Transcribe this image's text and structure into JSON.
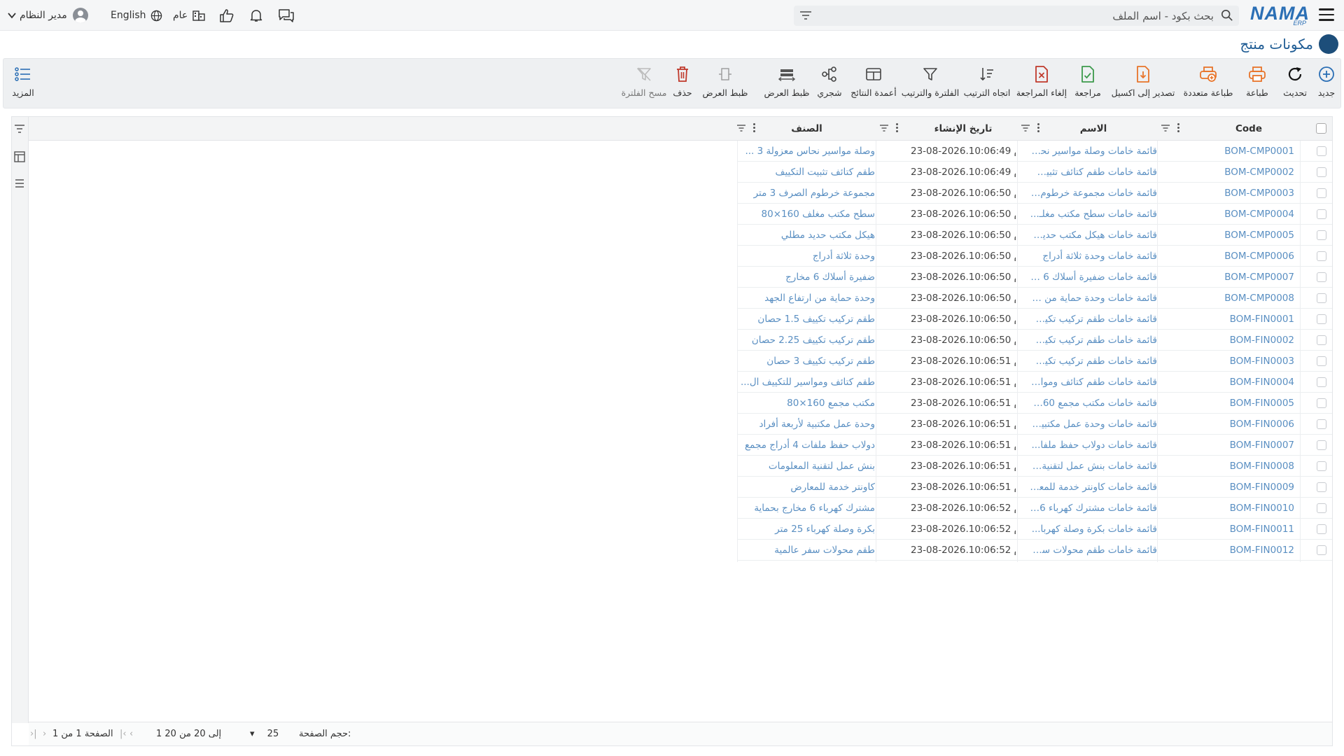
{
  "topbar": {
    "search_placeholder": "بحث بكود - اسم الملف",
    "logo_text": "NAMA",
    "logo_sub": "ERP",
    "user_label": "مدير النظام",
    "language_label": "English",
    "branch_label": "عام"
  },
  "page": {
    "title": "مكونات منتج"
  },
  "toolbar": {
    "new": "جديد",
    "refresh": "تحديث",
    "print": "طباعة",
    "multi_print": "طباعة متعددة",
    "export_excel": "تصدير إلى اكسيل",
    "review": "مراجعة",
    "cancel_review": "إلغاء المراجعة",
    "sort_direction": "اتجاه الترتيب",
    "filter_sort": "الفلترة والترتيب",
    "result_columns": "أعمدة النتائج",
    "tree": "شجري",
    "fit_width_1": "ظبط العرض",
    "fit_width_2": "ظبط العرض",
    "delete": "حذف",
    "clear_filter": "مسح الفلترة",
    "more": "المزيد"
  },
  "grid": {
    "columns": {
      "code": "Code",
      "name": "الاسم",
      "created": "تاريخ الإنشاء",
      "category": "الصنف"
    },
    "rows": [
      {
        "code": "BOM-CMP0001",
        "name": "قائمة خامات وصلة مواسير نحا...",
        "created": "23-08-2026.10:06:49 م",
        "category": "وصلة مواسير نحاس معزولة 3 ..."
      },
      {
        "code": "BOM-CMP0002",
        "name": "قائمة خامات طقم كتائف تثبيت...",
        "created": "23-08-2026.10:06:49 م",
        "category": "طقم كتائف تثبيت التكييف"
      },
      {
        "code": "BOM-CMP0003",
        "name": "قائمة خامات مجموعة خرطوم ال...",
        "created": "23-08-2026.10:06:50 م",
        "category": "مجموعة خرطوم الصرف 3 متر"
      },
      {
        "code": "BOM-CMP0004",
        "name": "قائمة خامات سطح مكتب مغلـ...",
        "created": "23-08-2026.10:06:50 م",
        "category": "سطح مكتب مغلف 160×80"
      },
      {
        "code": "BOM-CMP0005",
        "name": "قائمة خامات هيكل مكتب حديد ...",
        "created": "23-08-2026.10:06:50 م",
        "category": "هيكل مكتب حديد مطلي"
      },
      {
        "code": "BOM-CMP0006",
        "name": "قائمة خامات وحدة ثلاثة أدراج",
        "created": "23-08-2026.10:06:50 م",
        "category": "وحدة ثلاثة أدراج"
      },
      {
        "code": "BOM-CMP0007",
        "name": "قائمة خامات ضفيرة أسلاك 6 م...",
        "created": "23-08-2026.10:06:50 م",
        "category": "ضفيرة أسلاك 6 مخارج"
      },
      {
        "code": "BOM-CMP0008",
        "name": "قائمة خامات وحدة حماية من ارت...",
        "created": "23-08-2026.10:06:50 م",
        "category": "وحدة حماية من ارتفاع الجهد"
      },
      {
        "code": "BOM-FIN0001",
        "name": "قائمة خامات طقم تركيب تكيي...",
        "created": "23-08-2026.10:06:50 م",
        "category": "طقم تركيب تكييف 1.5 حصان"
      },
      {
        "code": "BOM-FIN0002",
        "name": "قائمة خامات طقم تركيب تكيي...",
        "created": "23-08-2026.10:06:50 م",
        "category": "طقم تركيب تكييف 2.25 حصان"
      },
      {
        "code": "BOM-FIN0003",
        "name": "قائمة خامات طقم تركيب تكيي...",
        "created": "23-08-2026.10:06:51 م",
        "category": "طقم تركيب تكييف 3 حصان"
      },
      {
        "code": "BOM-FIN0004",
        "name": "قائمة خامات طقم كتائف ومواـ...",
        "created": "23-08-2026.10:06:51 م",
        "category": "طقم كتائف ومواسير للتكييف ال..."
      },
      {
        "code": "BOM-FIN0005",
        "name": "قائمة خامات مكتب مجمع 160...",
        "created": "23-08-2026.10:06:51 م",
        "category": "مكتب مجمع 160×80"
      },
      {
        "code": "BOM-FIN0006",
        "name": "قائمة خامات وحدة عمل مكتبية ...",
        "created": "23-08-2026.10:06:51 م",
        "category": "وحدة عمل مكتبية لأربعة أفراد"
      },
      {
        "code": "BOM-FIN0007",
        "name": "قائمة خامات دولاب حفظ ملفا...",
        "created": "23-08-2026.10:06:51 م",
        "category": "دولاب حفظ ملفات 4 أدراج مجمع"
      },
      {
        "code": "BOM-FIN0008",
        "name": "قائمة خامات بنش عمل لتقنية ا...",
        "created": "23-08-2026.10:06:51 م",
        "category": "بنش عمل لتقنية المعلومات"
      },
      {
        "code": "BOM-FIN0009",
        "name": "قائمة خامات كاونتر خدمة للمعا...",
        "created": "23-08-2026.10:06:51 م",
        "category": "كاونتر خدمة للمعارض"
      },
      {
        "code": "BOM-FIN0010",
        "name": "قائمة خامات مشترك كهرباء 6 ...",
        "created": "23-08-2026.10:06:52 م",
        "category": "مشترك كهرباء 6 مخارج بحماية"
      },
      {
        "code": "BOM-FIN0011",
        "name": "قائمة خامات بكرة وصلة كهربا...",
        "created": "23-08-2026.10:06:52 م",
        "category": "بكرة وصلة كهرباء 25 متر"
      },
      {
        "code": "BOM-FIN0012",
        "name": "قائمة خامات طقم محولات سفـ...",
        "created": "23-08-2026.10:06:52 م",
        "category": "طقم محولات سفر عالمية"
      }
    ]
  },
  "pager": {
    "page_size_label": "حجم الصفحة:",
    "page_size": "25",
    "range": "1 إلى 20 من 20",
    "page_info": "الصفحة 1 من 1"
  },
  "colors": {
    "accent": "#2b6fb5",
    "link": "#5a8fc2",
    "orange": "#e8742a",
    "delete_red": "#c0392b",
    "review_green": "#3c9a4c"
  }
}
